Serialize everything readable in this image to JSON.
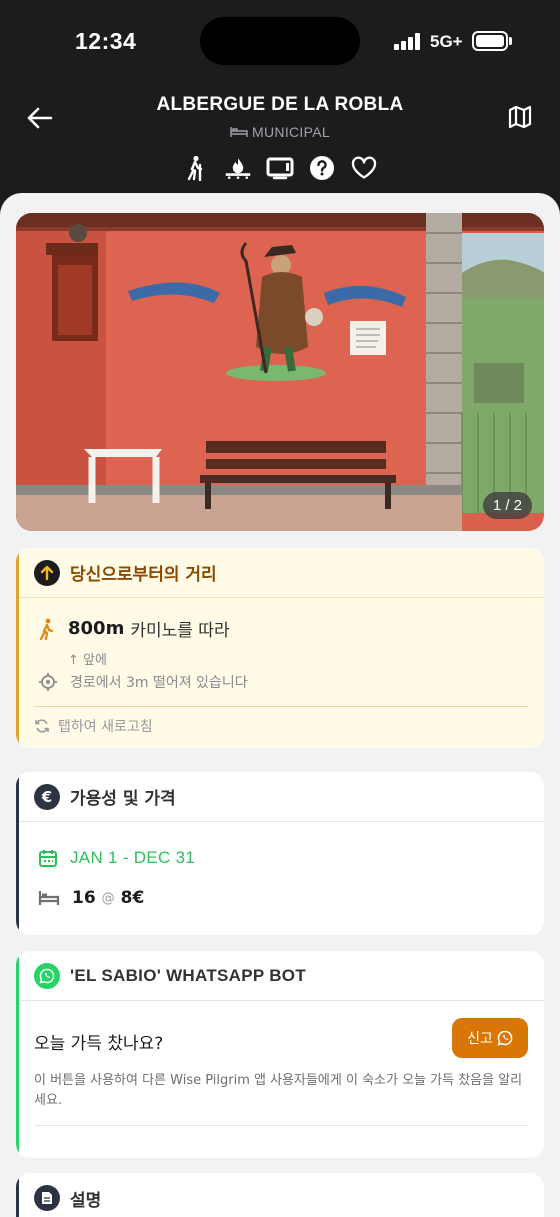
{
  "status": {
    "time": "12:34",
    "network": "5G+"
  },
  "header": {
    "title": "ALBERGUE DE LA ROBLA",
    "subtitle": "MUNICIPAL",
    "amenities": [
      "hiker-icon",
      "fire-icon",
      "tv-icon",
      "help-icon",
      "heart-icon"
    ]
  },
  "photo": {
    "counter": "1 / 2"
  },
  "distance": {
    "title": "당신으로부터의 거리",
    "amount": "800m",
    "along": "카미노를 따라",
    "direction": "↑ 앞에",
    "offroute": "경로에서 3m 떨어져 있습니다",
    "refresh": "탭하여 새로고침"
  },
  "availability": {
    "title": "가용성 및 가격",
    "dates": "JAN 1 - DEC 31",
    "beds": "16",
    "at": "@",
    "price": "8€"
  },
  "whatsapp": {
    "title": "'EL SABIO' WHATSAPP BOT",
    "question": "오늘 가득 찼나요?",
    "button": "신고",
    "description": "이 버튼을 사용하여 다른 Wise Pilgrim 앱 사용자들에게 이 숙소가 오늘 가득 찼음을 알리세요."
  },
  "description": {
    "title": "설명"
  },
  "colors": {
    "accent_amber": "#d97706",
    "distance_bar": "#e0a526",
    "availability_bar": "#2c3444",
    "whatsapp_green": "#25d366",
    "date_green": "#2fbf5a"
  }
}
